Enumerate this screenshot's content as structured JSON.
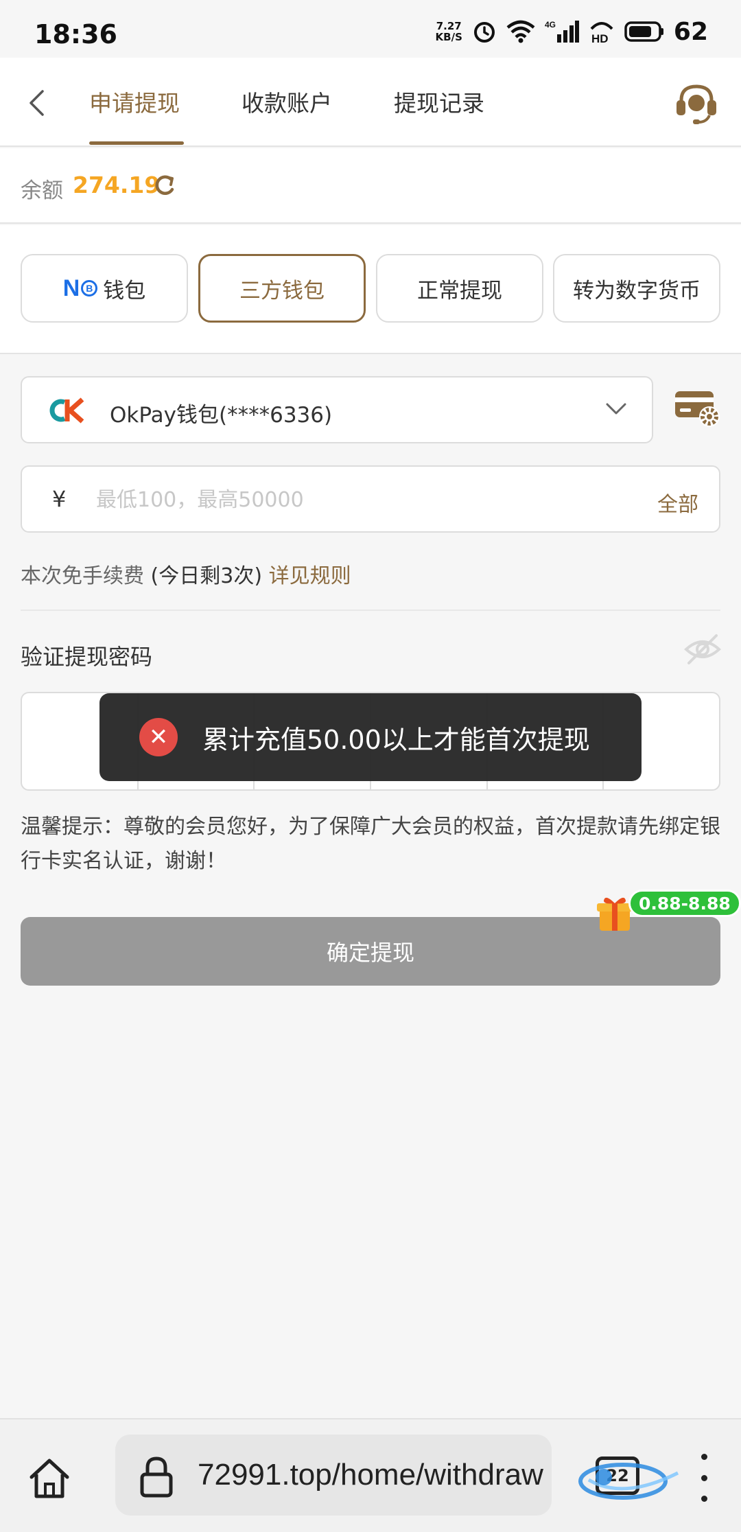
{
  "status_bar": {
    "time": "18:36",
    "net_speed_value": "7.27",
    "net_speed_unit": "KB/S",
    "signal_label": "4G",
    "hd_label": "HD",
    "battery": "62"
  },
  "header": {
    "tabs": [
      {
        "label": "申请提现",
        "active": true
      },
      {
        "label": "收款账户",
        "active": false
      },
      {
        "label": "提现记录",
        "active": false
      }
    ]
  },
  "balance": {
    "label": "余额",
    "value": "274.19"
  },
  "wallet_tabs": [
    {
      "logo_text": "N",
      "logo_badge": "B",
      "label": "钱包",
      "active": false
    },
    {
      "label": "三方钱包",
      "active": true
    },
    {
      "label": "正常提现",
      "active": false
    },
    {
      "label": "转为数字货币",
      "active": false
    }
  ],
  "account_select": {
    "selected": "OkPay钱包(****6336)"
  },
  "amount": {
    "currency": "¥",
    "placeholder": "最低100，最高50000",
    "all_label": "全部"
  },
  "fee": {
    "text": "本次免手续费",
    "count": "(今日剩3次)",
    "rules_link": "详见规则"
  },
  "password": {
    "label": "验证提现密码",
    "digits": 6
  },
  "toast": {
    "message": "累计充值50.00以上才能首次提现"
  },
  "tip": {
    "text": "温馨提示：尊敬的会员您好，为了保障广大会员的权益，首次提款请先绑定银行卡实名认证，谢谢！"
  },
  "submit": {
    "label": "确定提现"
  },
  "gift_badge": {
    "label": "0.88-8.88"
  },
  "browser": {
    "url": "72991.top/home/withdraw",
    "tab_count": "22"
  },
  "colors": {
    "accent": "#8b6a3e",
    "balance": "#f5a623",
    "toast_bg": "#282828",
    "error": "#e34c46",
    "badge": "#2ec03a",
    "disabled_button": "#999999"
  }
}
